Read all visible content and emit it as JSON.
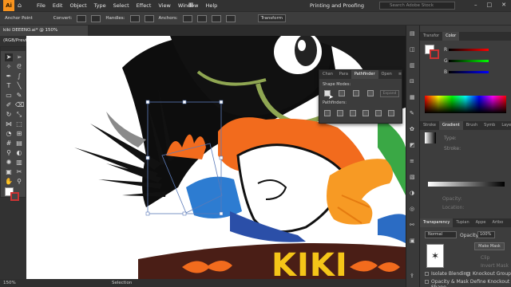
{
  "app": {
    "logo": "Ai"
  },
  "menu": {
    "items": [
      "File",
      "Edit",
      "Object",
      "Type",
      "Select",
      "Effect",
      "View",
      "Window",
      "Help"
    ]
  },
  "workspace": "Printing and Proofing",
  "search": {
    "placeholder": "Search Adobe Stock"
  },
  "controlbar": {
    "selection_label": "Anchor Point",
    "convert_label": "Convert:",
    "handles_label": "Handles:",
    "anchors_label": "Anchors:",
    "transform_label": "Transform"
  },
  "document_tab": {
    "label": "kiki DEEENO.ai* @ 150% (RGB/Preview)"
  },
  "pathfinder": {
    "tabs": [
      "Chan",
      "Para",
      "Pathfinder",
      "Open"
    ],
    "active_tab": "Pathfinder",
    "shape_modes_label": "Shape Modes:",
    "pathfinders_label": "Pathfinders:",
    "expand_label": "Expand"
  },
  "swatches_panel": {
    "tabs": [
      "Transfor",
      "Color"
    ],
    "active_tab": "Color",
    "fields": [
      "R",
      "G",
      "B"
    ]
  },
  "gradient_panel": {
    "tabs": [
      "Stroke",
      "Gradient",
      "Brush",
      "Symb",
      "Laye"
    ],
    "active_tab": "Gradient",
    "type_label": "Type:",
    "stroke_label": "Stroke:",
    "opacity_label": "Opacity:",
    "location_label": "Location:"
  },
  "transparency_panel": {
    "tabs": [
      "Transparency",
      "Tupian",
      "Appe",
      "Artbo"
    ],
    "active_tab": "Transparency",
    "blend_mode": "Normal",
    "opacity_label": "Opacity:",
    "opacity_value": "100%",
    "make_mask": "Make Mask",
    "clip_label": "Clip",
    "invert_label": "Invert Mask",
    "isolate_label": "Isolate Blending",
    "knockout_label": "Knockout Group",
    "opacity_mask_label": "Opacity & Mask Define Knockout Shape"
  },
  "artwork": {
    "text": "KIKI"
  },
  "status": {
    "zoom": "150%",
    "mode": "Selection"
  },
  "colors": {
    "accent": "#f7931e",
    "kiki_yellow": "#f5c518",
    "orange": "#f26b1d",
    "banner": "#4a1e16",
    "selection": "#5b7ab8"
  }
}
